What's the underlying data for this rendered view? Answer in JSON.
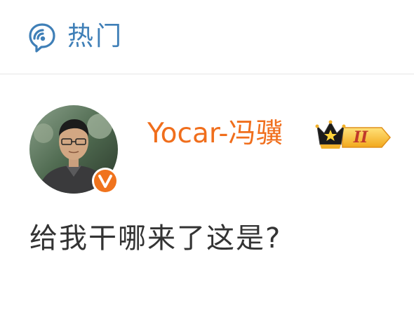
{
  "header": {
    "title": "热门",
    "icon": "hot-topic-bubble-icon",
    "accent_color": "#3f7fb7"
  },
  "post": {
    "author": {
      "name": "Yocar-冯骥",
      "name_color": "#f06e1c",
      "avatar": "user-avatar",
      "verified_icon": "verified-v-icon",
      "vip_badge": {
        "icon": "crown-vip-icon",
        "level": "II"
      }
    },
    "text": "给我干哪来了这是?"
  }
}
